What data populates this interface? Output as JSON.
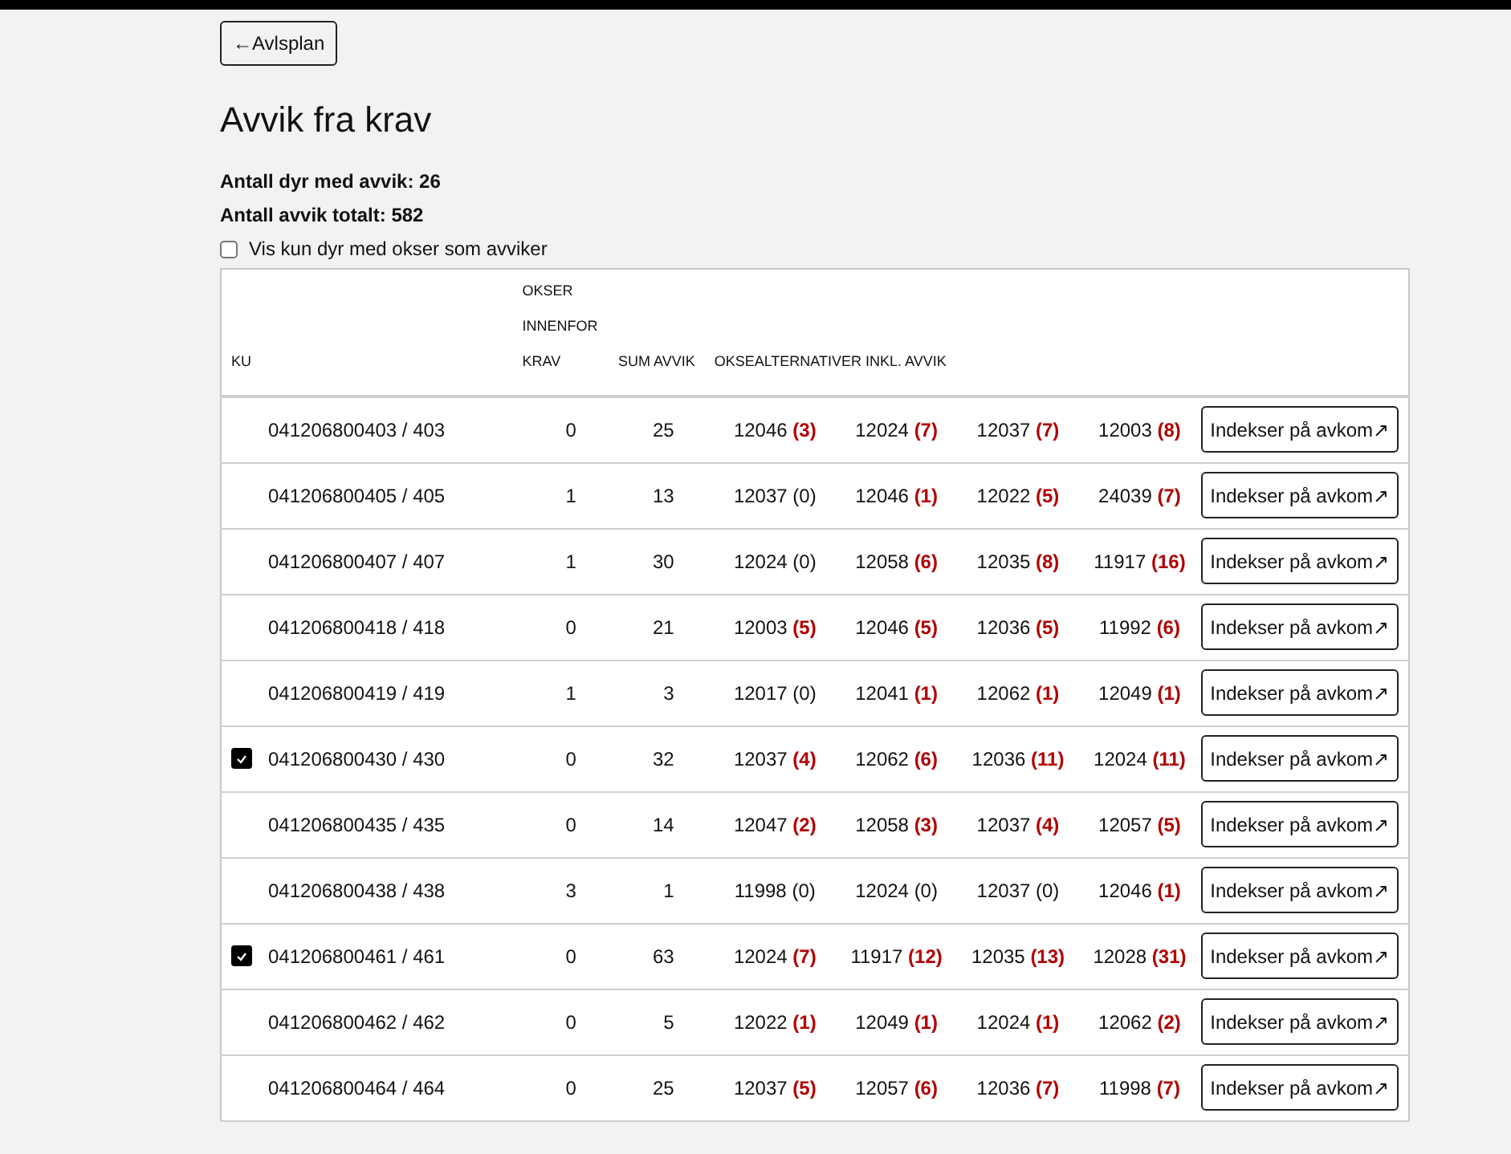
{
  "back_button": {
    "label": "←Avlsplan"
  },
  "title": "Avvik fra krav",
  "summary": [
    "Antall dyr med avvik: 26",
    "Antall avvik totalt: 582"
  ],
  "filter": {
    "label": "Vis kun dyr med okser som avviker",
    "checked": false
  },
  "table": {
    "columns": [
      {
        "lines": [
          "KU"
        ]
      },
      {
        "lines": [
          "OKSER",
          "INNENFOR",
          "KRAV"
        ]
      },
      {
        "lines": [
          "SUM AVVIK"
        ]
      },
      {
        "lines": [
          "OKSEALTERNATIVER INKL. AVVIK"
        ]
      }
    ],
    "rows": [
      {
        "checked": false,
        "ku": "041206800403 / 403",
        "within": "0",
        "sum": "25",
        "alternatives": [
          {
            "bull": "12046",
            "count": "(3)",
            "deviates": true
          },
          {
            "bull": "12024",
            "count": "(7)",
            "deviates": true
          },
          {
            "bull": "12037",
            "count": "(7)",
            "deviates": true
          },
          {
            "bull": "12003",
            "count": "(8)",
            "deviates": true
          }
        ],
        "action": "Indekser på avkom↗"
      },
      {
        "checked": false,
        "ku": "041206800405 / 405",
        "within": "1",
        "sum": "13",
        "alternatives": [
          {
            "bull": "12037",
            "count": "(0)",
            "deviates": false
          },
          {
            "bull": "12046",
            "count": "(1)",
            "deviates": true
          },
          {
            "bull": "12022",
            "count": "(5)",
            "deviates": true
          },
          {
            "bull": "24039",
            "count": "(7)",
            "deviates": true
          }
        ],
        "action": "Indekser på avkom↗"
      },
      {
        "checked": false,
        "ku": "041206800407 / 407",
        "within": "1",
        "sum": "30",
        "alternatives": [
          {
            "bull": "12024",
            "count": "(0)",
            "deviates": false
          },
          {
            "bull": "12058",
            "count": "(6)",
            "deviates": true
          },
          {
            "bull": "12035",
            "count": "(8)",
            "deviates": true
          },
          {
            "bull": "11917",
            "count": "(16)",
            "deviates": true
          }
        ],
        "action": "Indekser på avkom↗"
      },
      {
        "checked": false,
        "ku": "041206800418 / 418",
        "within": "0",
        "sum": "21",
        "alternatives": [
          {
            "bull": "12003",
            "count": "(5)",
            "deviates": true
          },
          {
            "bull": "12046",
            "count": "(5)",
            "deviates": true
          },
          {
            "bull": "12036",
            "count": "(5)",
            "deviates": true
          },
          {
            "bull": "11992",
            "count": "(6)",
            "deviates": true
          }
        ],
        "action": "Indekser på avkom↗"
      },
      {
        "checked": false,
        "ku": "041206800419 / 419",
        "within": "1",
        "sum": "3",
        "alternatives": [
          {
            "bull": "12017",
            "count": "(0)",
            "deviates": false
          },
          {
            "bull": "12041",
            "count": "(1)",
            "deviates": true
          },
          {
            "bull": "12062",
            "count": "(1)",
            "deviates": true
          },
          {
            "bull": "12049",
            "count": "(1)",
            "deviates": true
          }
        ],
        "action": "Indekser på avkom↗"
      },
      {
        "checked": true,
        "ku": "041206800430 / 430",
        "within": "0",
        "sum": "32",
        "alternatives": [
          {
            "bull": "12037",
            "count": "(4)",
            "deviates": true
          },
          {
            "bull": "12062",
            "count": "(6)",
            "deviates": true
          },
          {
            "bull": "12036",
            "count": "(11)",
            "deviates": true
          },
          {
            "bull": "12024",
            "count": "(11)",
            "deviates": true
          }
        ],
        "action": "Indekser på avkom↗"
      },
      {
        "checked": false,
        "ku": "041206800435 / 435",
        "within": "0",
        "sum": "14",
        "alternatives": [
          {
            "bull": "12047",
            "count": "(2)",
            "deviates": true
          },
          {
            "bull": "12058",
            "count": "(3)",
            "deviates": true
          },
          {
            "bull": "12037",
            "count": "(4)",
            "deviates": true
          },
          {
            "bull": "12057",
            "count": "(5)",
            "deviates": true
          }
        ],
        "action": "Indekser på avkom↗"
      },
      {
        "checked": false,
        "ku": "041206800438 / 438",
        "within": "3",
        "sum": "1",
        "alternatives": [
          {
            "bull": "11998",
            "count": "(0)",
            "deviates": false
          },
          {
            "bull": "12024",
            "count": "(0)",
            "deviates": false
          },
          {
            "bull": "12037",
            "count": "(0)",
            "deviates": false
          },
          {
            "bull": "12046",
            "count": "(1)",
            "deviates": true
          }
        ],
        "action": "Indekser på avkom↗"
      },
      {
        "checked": true,
        "ku": "041206800461 / 461",
        "within": "0",
        "sum": "63",
        "alternatives": [
          {
            "bull": "12024",
            "count": "(7)",
            "deviates": true
          },
          {
            "bull": "11917",
            "count": "(12)",
            "deviates": true
          },
          {
            "bull": "12035",
            "count": "(13)",
            "deviates": true
          },
          {
            "bull": "12028",
            "count": "(31)",
            "deviates": true
          }
        ],
        "action": "Indekser på avkom↗"
      },
      {
        "checked": false,
        "ku": "041206800462 / 462",
        "within": "0",
        "sum": "5",
        "alternatives": [
          {
            "bull": "12022",
            "count": "(1)",
            "deviates": true
          },
          {
            "bull": "12049",
            "count": "(1)",
            "deviates": true
          },
          {
            "bull": "12024",
            "count": "(1)",
            "deviates": true
          },
          {
            "bull": "12062",
            "count": "(2)",
            "deviates": true
          }
        ],
        "action": "Indekser på avkom↗"
      },
      {
        "checked": false,
        "ku": "041206800464 / 464",
        "within": "0",
        "sum": "25",
        "alternatives": [
          {
            "bull": "12037",
            "count": "(5)",
            "deviates": true
          },
          {
            "bull": "12057",
            "count": "(6)",
            "deviates": true
          },
          {
            "bull": "12036",
            "count": "(7)",
            "deviates": true
          },
          {
            "bull": "11998",
            "count": "(7)",
            "deviates": true
          }
        ],
        "action": "Indekser på avkom↗"
      }
    ]
  }
}
